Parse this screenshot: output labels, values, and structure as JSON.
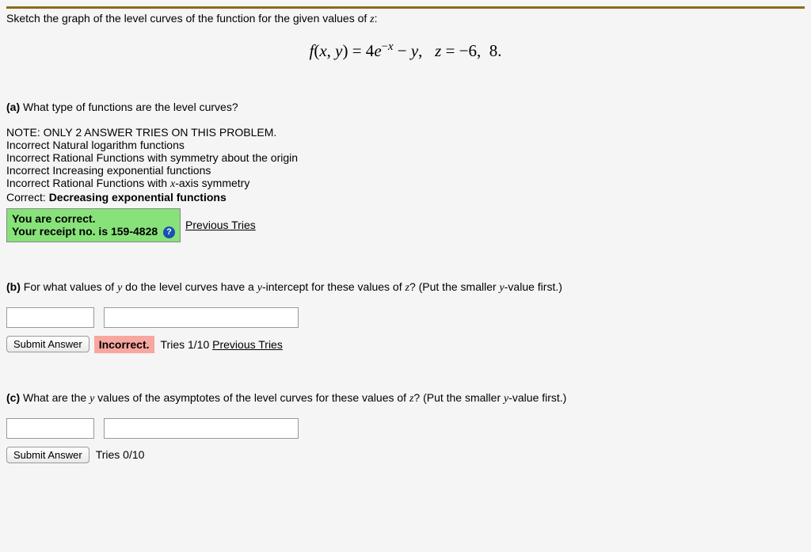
{
  "prompt": "Sketch the graph of the level curves of the function for the given values of ",
  "prompt_var": "z",
  "prompt_colon": ":",
  "equation": "f(x, y) = 4e⁻ˣ − y,   z = −6,  8.",
  "partA": {
    "label": "(a)",
    "question": " What type of functions are the level curves?",
    "note": "NOTE: ONLY 2 ANSWER TRIES ON THIS PROBLEM.",
    "options": [
      "Incorrect Natural logarithm functions",
      "Incorrect Rational Functions with symmetry about the origin",
      "Incorrect Increasing exponential functions",
      "Incorrect Rational Functions with x-axis symmetry"
    ],
    "option_x_prefix": "Incorrect Rational Functions with ",
    "option_x_suffix": "-axis symmetry",
    "correct_prefix": "Correct: ",
    "correct_answer": "Decreasing exponential functions",
    "feedback_line1": "You are correct.",
    "feedback_line2": "Your receipt no. is 159-4828",
    "help_icon": "?",
    "prev_tries": "Previous Tries"
  },
  "partB": {
    "label": "(b)",
    "question_prefix": " For what values of ",
    "var1": "y",
    "question_mid": " do the level curves have a ",
    "var2": "y",
    "question_mid2": "-intercept for these values of ",
    "var3": "z",
    "question_suffix": "? (Put the smaller ",
    "var4": "y",
    "question_end": "-value first.)",
    "submit": "Submit Answer",
    "incorrect": "Incorrect.",
    "tries": "Tries 1/10 ",
    "prev_tries": "Previous Tries"
  },
  "partC": {
    "label": "(c)",
    "question_prefix": " What are the ",
    "var1": "y",
    "question_mid": " values of the asymptotes of the level curves for these values of ",
    "var2": "z",
    "question_suffix": "? (Put the smaller ",
    "var3": "y",
    "question_end": "-value first.)",
    "submit": "Submit Answer",
    "tries": "Tries 0/10"
  }
}
